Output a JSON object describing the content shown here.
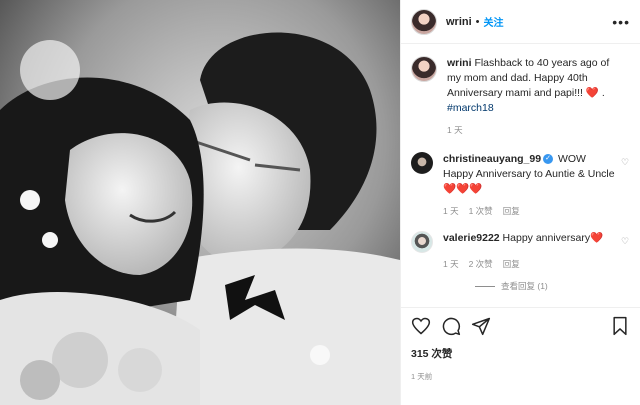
{
  "post": {
    "username": "wrini",
    "follow_label": "关注",
    "more_label": "•••"
  },
  "caption": {
    "username": "wrini",
    "text": "Flashback to 40 years ago of my mom and dad. Happy 40th Anniversary mami and papi!!! ",
    "heart": "❤️",
    "after": " .",
    "hashtag": "#march18",
    "time": "1 天"
  },
  "comments": [
    {
      "username": "christineauyang_99",
      "verified": true,
      "text": " WOW Happy Anniversary to Auntie & Uncle",
      "hearts": "❤️❤️❤️",
      "time": "1 天",
      "likes": "1 次赞",
      "reply": "回复"
    },
    {
      "username": "valerie9222",
      "text": " Happy anniversary",
      "hearts": "❤️",
      "time": "1 天",
      "likes": "2 次赞",
      "reply": "回复"
    }
  ],
  "view_replies": "查看回复 (1)",
  "likes_count": "315 次赞",
  "posted_time": "1 天前",
  "icons": [
    "heart-icon",
    "comment-icon",
    "share-icon",
    "bookmark-icon"
  ],
  "colors": {
    "follow": "#0095f6",
    "heart": "#ed4956",
    "muted": "#8e8e8e"
  }
}
